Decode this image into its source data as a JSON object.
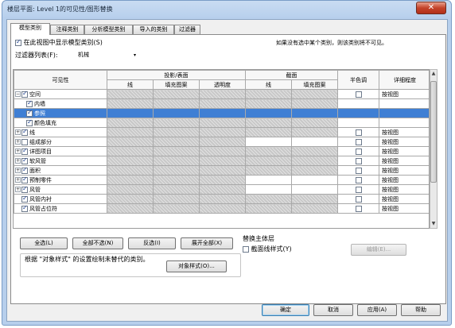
{
  "window": {
    "title": "楼层平面: Level 1的可见性/图形替换",
    "close_glyph": "✕"
  },
  "tabs": [
    {
      "label": "模型类别",
      "active": true
    },
    {
      "label": "注释类别",
      "active": false
    },
    {
      "label": "分析模型类别",
      "active": false
    },
    {
      "label": "导入的类别",
      "active": false
    },
    {
      "label": "过滤器",
      "active": false
    }
  ],
  "panel": {
    "show_model_categories_label": "在此视图中显示模型类别(S)",
    "show_model_categories_checked": true,
    "hint": "如果没有选中某个类别，则该类别将不可见。",
    "filter_list_label": "过滤器列表(F):",
    "filter_value": "机械",
    "filter_arrow_glyph": "▾"
  },
  "grid": {
    "headers": {
      "visibility": "可见性",
      "projection": "投影/表面",
      "cut": "截面",
      "halftone": "半色调",
      "detail_level": "详细程度",
      "line": "线",
      "fill_pattern": "填充图案",
      "transparency": "透明度",
      "cut_line": "线",
      "cut_fill_pattern": "填充图案"
    },
    "rows": [
      {
        "name": "空间",
        "level": 0,
        "expander": "−",
        "checked": true,
        "selected": false,
        "detail": "按视图",
        "cut": false
      },
      {
        "name": "内墙",
        "level": 1,
        "expander": "",
        "checked": true,
        "selected": false,
        "detail": "",
        "cut": false
      },
      {
        "name": "参照",
        "level": 1,
        "expander": "",
        "checked": true,
        "selected": true,
        "detail": "",
        "cut": false
      },
      {
        "name": "颜色填充",
        "level": 1,
        "expander": "",
        "checked": true,
        "selected": false,
        "detail": "",
        "cut": false
      },
      {
        "name": "线",
        "level": 0,
        "expander": "+",
        "checked": true,
        "selected": false,
        "detail": "按视图",
        "cut": false
      },
      {
        "name": "组成部分",
        "level": 0,
        "expander": "+",
        "checked": false,
        "selected": false,
        "detail": "按视图",
        "cut": true
      },
      {
        "name": "详图项目",
        "level": 0,
        "expander": "+",
        "checked": true,
        "selected": false,
        "detail": "按视图",
        "cut": false
      },
      {
        "name": "软风管",
        "level": 0,
        "expander": "+",
        "checked": true,
        "selected": false,
        "detail": "按视图",
        "cut": false
      },
      {
        "name": "面积",
        "level": 0,
        "expander": "+",
        "checked": true,
        "selected": false,
        "detail": "按视图",
        "cut": false
      },
      {
        "name": "预制零件",
        "level": 0,
        "expander": "+",
        "checked": true,
        "selected": false,
        "detail": "按视图",
        "cut": true
      },
      {
        "name": "风管",
        "level": 0,
        "expander": "+",
        "checked": true,
        "selected": false,
        "detail": "按视图",
        "cut": true
      },
      {
        "name": "风管内衬",
        "level": 0,
        "expander": "",
        "checked": true,
        "selected": false,
        "detail": "按视图",
        "cut": false
      },
      {
        "name": "风管占位符",
        "level": 0,
        "expander": "",
        "checked": true,
        "selected": false,
        "detail": "按视图",
        "cut": false
      }
    ]
  },
  "buttons": {
    "select_all": "全选(L)",
    "select_none": "全部不选(N)",
    "invert": "反选(I)",
    "expand_all": "展开全部(X)",
    "edit": "编辑(E)...",
    "object_styles": "对象样式(O)...",
    "ok": "确定",
    "cancel": "取消",
    "apply": "应用(A)",
    "help": "帮助"
  },
  "override_host": {
    "title": "替换主体层",
    "cut_line_style_label": "截面线样式(Y)",
    "checked": false
  },
  "footer_note": "根据 \"对象样式\" 的设置绘制未替代的类别。",
  "colors": {
    "selection": "#3f7fd4",
    "shaded_cell": "#c8c8c8",
    "window_frame": "#b7cfec",
    "close_button": "#c4432a"
  }
}
